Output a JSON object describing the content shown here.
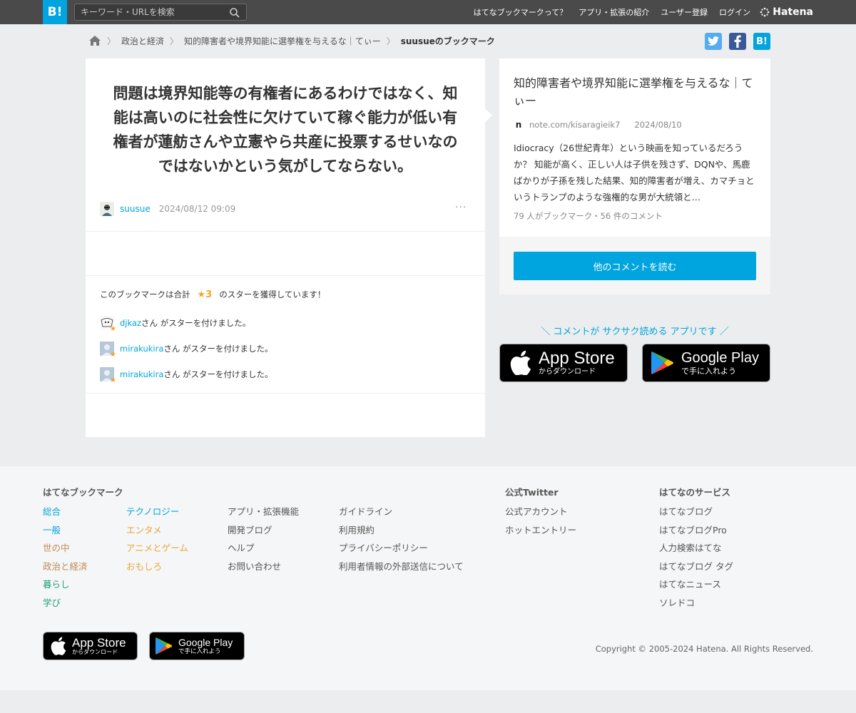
{
  "header": {
    "logo_text": "B!",
    "search_placeholder": "キーワード・URLを検索",
    "nav": [
      "はてなブックマークって？",
      "アプリ・拡張の紹介",
      "ユーザー登録",
      "ログイン"
    ],
    "brand": "Hatena"
  },
  "breadcrumb": {
    "items": [
      "政治と経済",
      "知的障害者や境界知能に選挙権を与えるな｜てぃー",
      "suusueのブックマーク"
    ]
  },
  "share": {
    "hatena_label": "B!"
  },
  "bookmark": {
    "comment": "問題は境界知能等の有権者にあるわけではなく、知能は高いのに社会性に欠けていて稼ぐ能力が低い有権者が蓮舫さんや立憲やら共産に投票するせいなのではないかという気がしてならない。",
    "user": "suusue",
    "timestamp": "2024/08/12 09:09",
    "more": "···"
  },
  "stars": {
    "summary_prefix": "このブックマークは合計",
    "count": "★3",
    "summary_suffix": "のスターを獲得しています！",
    "entries": [
      {
        "user": "djkaz",
        "text": "さん がスターを付けました。"
      },
      {
        "user": "mirakukira",
        "text": "さん がスターを付けました。"
      },
      {
        "user": "mirakukira",
        "text": "さん がスターを付けました。"
      }
    ]
  },
  "entry": {
    "title": "知的障害者や境界知能に選挙権を与えるな｜てぃー",
    "favicon": "n",
    "domain": "note.com/kisaragieik7",
    "date": "2024/08/10",
    "description": "Idiocracy（26世紀青年）という映画を知っているだろうか？ 知能が高く、正しい人は子供を残さず、DQNや、馬鹿ばかりが子孫を残した結果、知的障害者が増え、カマチョというトランプのような強権的な男が大統領と…",
    "counts": "79 人がブックマーク・56 件のコメント",
    "read_more": "他のコメントを読む"
  },
  "app_promo": {
    "text": "＼ コメントが サクサク読める アプリです ／",
    "appstore_big": "App Store",
    "appstore_small": "からダウンロード",
    "googleplay_big": "Google Play",
    "googleplay_small": "で手に入れよう"
  },
  "footer": {
    "col1_title": "はてなブックマーク",
    "categories_a": [
      "総合",
      "一般",
      "世の中",
      "政治と経済",
      "暮らし",
      "学び"
    ],
    "categories_b": [
      "テクノロジー",
      "エンタメ",
      "アニメとゲーム",
      "おもしろ"
    ],
    "links_c": [
      "アプリ・拡張機能",
      "開発ブログ",
      "ヘルプ",
      "お問い合わせ"
    ],
    "links_d": [
      "ガイドライン",
      "利用規約",
      "プライバシーポリシー",
      "利用者情報の外部送信について"
    ],
    "twitter_title": "公式Twitter",
    "twitter_links": [
      "公式アカウント",
      "ホットエントリー"
    ],
    "services_title": "はてなのサービス",
    "services": [
      "はてなブログ",
      "はてなブログPro",
      "人力検索はてな",
      "はてなブログ タグ",
      "はてなニュース",
      "ソレドコ"
    ],
    "copyright": "Copyright © 2005-2024 Hatena. All Rights Reserved."
  },
  "colors": {
    "accent": "#00a4de",
    "topbar": "#4a4a4a",
    "star": "#f5a623"
  }
}
